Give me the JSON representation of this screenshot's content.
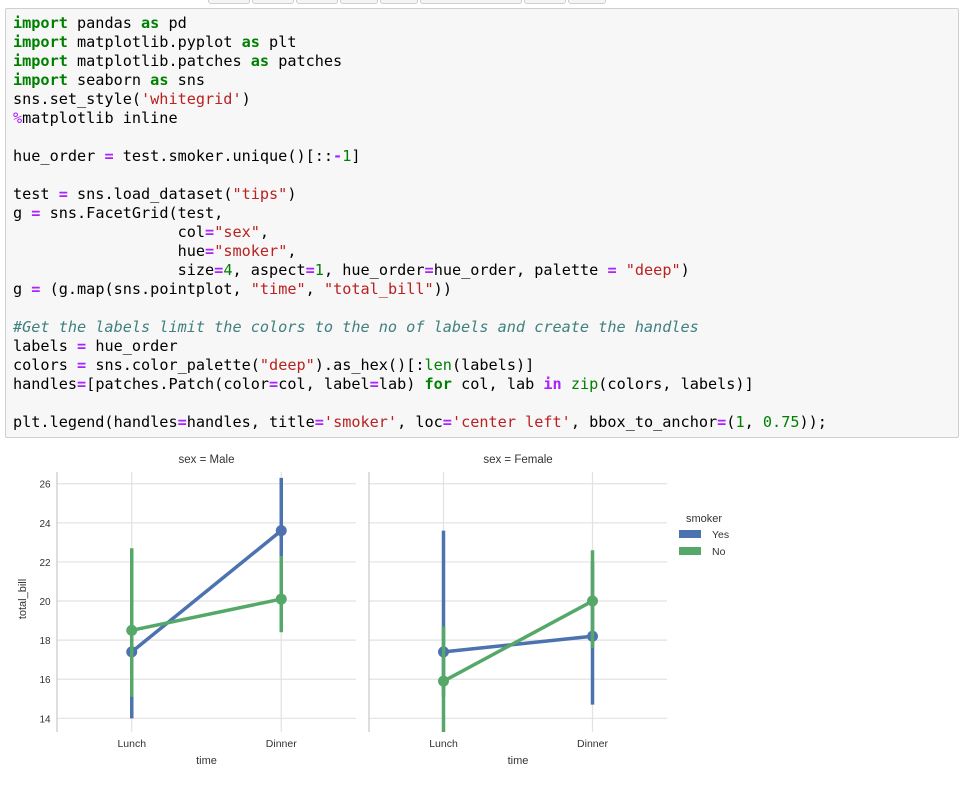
{
  "code_lines": [
    [
      {
        "t": "import",
        "c": "kw"
      },
      {
        "t": " pandas "
      },
      {
        "t": "as",
        "c": "kw"
      },
      {
        "t": " pd"
      }
    ],
    [
      {
        "t": "import",
        "c": "kw"
      },
      {
        "t": " matplotlib.pyplot "
      },
      {
        "t": "as",
        "c": "kw"
      },
      {
        "t": " plt"
      }
    ],
    [
      {
        "t": "import",
        "c": "kw"
      },
      {
        "t": " matplotlib.patches "
      },
      {
        "t": "as",
        "c": "kw"
      },
      {
        "t": " patches"
      }
    ],
    [
      {
        "t": "import",
        "c": "kw"
      },
      {
        "t": " seaborn "
      },
      {
        "t": "as",
        "c": "kw"
      },
      {
        "t": " sns"
      }
    ],
    [
      {
        "t": "sns.set_style("
      },
      {
        "t": "'whitegrid'",
        "c": "st"
      },
      {
        "t": ")"
      }
    ],
    [
      {
        "t": "%",
        "c": "mg"
      },
      {
        "t": "matplotlib inline"
      }
    ],
    [],
    [
      {
        "t": "hue_order "
      },
      {
        "t": "=",
        "c": "op"
      },
      {
        "t": " test.smoker.unique()[::"
      },
      {
        "t": "-",
        "c": "op"
      },
      {
        "t": "1",
        "c": "num"
      },
      {
        "t": "]"
      }
    ],
    [],
    [
      {
        "t": "test "
      },
      {
        "t": "=",
        "c": "op"
      },
      {
        "t": " sns.load_dataset("
      },
      {
        "t": "\"tips\"",
        "c": "st"
      },
      {
        "t": ")"
      }
    ],
    [
      {
        "t": "g "
      },
      {
        "t": "=",
        "c": "op"
      },
      {
        "t": " sns.FacetGrid(test,"
      }
    ],
    [
      {
        "t": "                  col"
      },
      {
        "t": "=",
        "c": "op"
      },
      {
        "t": "\"sex\"",
        "c": "st"
      },
      {
        "t": ","
      }
    ],
    [
      {
        "t": "                  hue"
      },
      {
        "t": "=",
        "c": "op"
      },
      {
        "t": "\"smoker\"",
        "c": "st"
      },
      {
        "t": ","
      }
    ],
    [
      {
        "t": "                  size"
      },
      {
        "t": "=",
        "c": "op"
      },
      {
        "t": "4",
        "c": "num"
      },
      {
        "t": ", aspect"
      },
      {
        "t": "=",
        "c": "op"
      },
      {
        "t": "1",
        "c": "num"
      },
      {
        "t": ", hue_order"
      },
      {
        "t": "=",
        "c": "op"
      },
      {
        "t": "hue_order, palette "
      },
      {
        "t": "=",
        "c": "op"
      },
      {
        "t": " "
      },
      {
        "t": "\"deep\"",
        "c": "st"
      },
      {
        "t": ")"
      }
    ],
    [
      {
        "t": "g "
      },
      {
        "t": "=",
        "c": "op"
      },
      {
        "t": " (g.map(sns.pointplot, "
      },
      {
        "t": "\"time\"",
        "c": "st"
      },
      {
        "t": ", "
      },
      {
        "t": "\"total_bill\"",
        "c": "st"
      },
      {
        "t": "))"
      }
    ],
    [],
    [
      {
        "t": "#Get the labels limit the colors to the no of labels and create the handles",
        "c": "cm"
      }
    ],
    [
      {
        "t": "labels "
      },
      {
        "t": "=",
        "c": "op"
      },
      {
        "t": " hue_order"
      }
    ],
    [
      {
        "t": "colors "
      },
      {
        "t": "=",
        "c": "op"
      },
      {
        "t": " sns.color_palette("
      },
      {
        "t": "\"deep\"",
        "c": "st"
      },
      {
        "t": ").as_hex()[:"
      },
      {
        "t": "len",
        "c": "bi"
      },
      {
        "t": "(labels)]"
      }
    ],
    [
      {
        "t": "handles"
      },
      {
        "t": "=",
        "c": "op"
      },
      {
        "t": "[patches.Patch(color"
      },
      {
        "t": "=",
        "c": "op"
      },
      {
        "t": "col, label"
      },
      {
        "t": "=",
        "c": "op"
      },
      {
        "t": "lab) "
      },
      {
        "t": "for",
        "c": "kw"
      },
      {
        "t": " col, lab "
      },
      {
        "t": "in",
        "c": "op"
      },
      {
        "t": " "
      },
      {
        "t": "zip",
        "c": "bi"
      },
      {
        "t": "(colors, labels)]"
      }
    ],
    [],
    [
      {
        "t": "plt.legend(handles"
      },
      {
        "t": "=",
        "c": "op"
      },
      {
        "t": "handles, title"
      },
      {
        "t": "=",
        "c": "op"
      },
      {
        "t": "'smoker'",
        "c": "st"
      },
      {
        "t": ", loc"
      },
      {
        "t": "=",
        "c": "op"
      },
      {
        "t": "'center left'",
        "c": "st"
      },
      {
        "t": ", bbox_to_anchor"
      },
      {
        "t": "=",
        "c": "op"
      },
      {
        "t": "("
      },
      {
        "t": "1",
        "c": "num"
      },
      {
        "t": ", "
      },
      {
        "t": "0.75",
        "c": "num"
      },
      {
        "t": "));"
      }
    ]
  ],
  "chart_data": {
    "type": "line",
    "chart_style": "pointplot",
    "facets": [
      {
        "title": "sex = Male",
        "categories": [
          "Lunch",
          "Dinner"
        ],
        "series": [
          {
            "name": "Yes",
            "values": [
              17.4,
              23.6
            ],
            "ci_low": [
              14.0,
              22.3
            ],
            "ci_high": [
              19.0,
              26.3
            ]
          },
          {
            "name": "No",
            "values": [
              18.5,
              20.1
            ],
            "ci_low": [
              15.1,
              18.4
            ],
            "ci_high": [
              22.7,
              22.3
            ]
          }
        ]
      },
      {
        "title": "sex = Female",
        "categories": [
          "Lunch",
          "Dinner"
        ],
        "series": [
          {
            "name": "Yes",
            "values": [
              17.4,
              18.2
            ],
            "ci_low": [
              15.1,
              14.7
            ],
            "ci_high": [
              23.6,
              22.0
            ]
          },
          {
            "name": "No",
            "values": [
              15.9,
              20.0
            ],
            "ci_low": [
              13.3,
              17.6
            ],
            "ci_high": [
              18.7,
              22.6
            ]
          }
        ]
      }
    ],
    "xlabel": "time",
    "ylabel": "total_bill",
    "ylim": [
      13.3,
      26.6
    ],
    "yticks": [
      14,
      16,
      18,
      20,
      22,
      24,
      26
    ],
    "grid": true,
    "legend": {
      "title": "smoker",
      "entries": [
        "Yes",
        "No"
      ],
      "placement": "center-right"
    },
    "colors": {
      "Yes": "#4c72b0",
      "No": "#55a868"
    }
  }
}
